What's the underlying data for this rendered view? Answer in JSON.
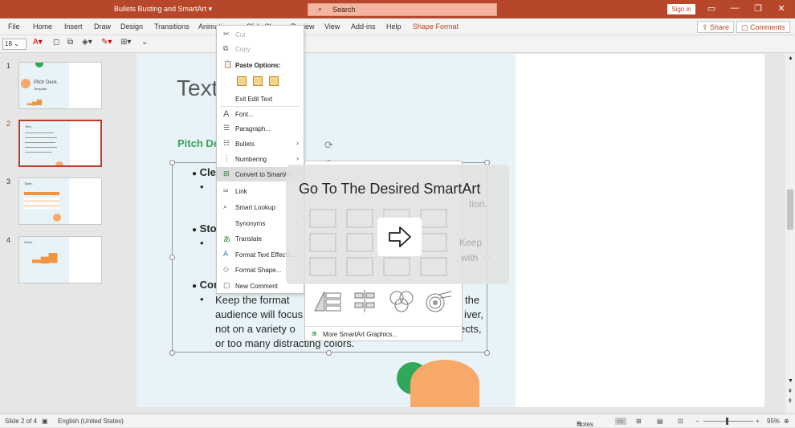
{
  "app": {
    "document_title": "Bullets Busting and SmartArt",
    "search_placeholder": "Search",
    "sign_in": "Sign in",
    "brand_color": "#b7472a"
  },
  "menu": {
    "items": [
      "File",
      "Home",
      "Insert",
      "Draw",
      "Design",
      "Transitions",
      "Animations",
      "Slide Show",
      "Review",
      "View",
      "Add-ins",
      "Help",
      "Shape Format"
    ],
    "share": "Share",
    "comments": "Comments"
  },
  "toolbar": {
    "font_size": "18"
  },
  "thumbnails": [
    {
      "number": "1",
      "title": "Pitch Deck.",
      "subtitle": "Template"
    },
    {
      "number": "2",
      "title": "Text..",
      "subtitle": ""
    },
    {
      "number": "3",
      "title": "Table..",
      "subtitle": ""
    },
    {
      "number": "4",
      "title": "Chart..",
      "subtitle": ""
    }
  ],
  "slide": {
    "title": "Text",
    "subheading": "Pitch De",
    "bullets": [
      {
        "head": "Clear",
        "sub": []
      },
      {
        "head": "Story",
        "sub": []
      },
      {
        "head": "Cons",
        "sub": [
          "Keep the format",
          "the",
          "audience will focus",
          "iver,",
          "not on a variety o",
          "ects,",
          "or too many distracting colors."
        ]
      }
    ],
    "peek_text": [
      "tion.",
      "Keep",
      "with"
    ]
  },
  "context_menu": {
    "items": [
      {
        "label": "Cut",
        "icon": "cut-icon",
        "disabled": true
      },
      {
        "label": "Copy",
        "icon": "copy-icon",
        "disabled": true
      },
      {
        "label": "Paste Options:",
        "icon": "paste-icon",
        "bold": true
      },
      {
        "label": "Exit Edit Text",
        "icon": ""
      },
      {
        "label": "Font...",
        "icon": "font-icon"
      },
      {
        "label": "Paragraph...",
        "icon": "paragraph-icon"
      },
      {
        "label": "Bullets",
        "icon": "bullets-icon",
        "submenu": true
      },
      {
        "label": "Numbering",
        "icon": "numbering-icon",
        "submenu": true
      },
      {
        "label": "Convert to SmartArt",
        "icon": "smartart-icon",
        "submenu": true,
        "hover": true
      },
      {
        "label": "Link",
        "icon": "link-icon"
      },
      {
        "label": "Smart Lookup",
        "icon": "search-icon"
      },
      {
        "label": "Synonyms",
        "icon": "",
        "submenu": true
      },
      {
        "label": "Translate",
        "icon": "translate-icon"
      },
      {
        "label": "Format Text Effects...",
        "icon": "text-effects-icon"
      },
      {
        "label": "Format Shape...",
        "icon": "format-shape-icon"
      },
      {
        "label": "New Comment",
        "icon": "comment-icon"
      }
    ]
  },
  "smartart": {
    "more_label": "More SmartArt Graphics..."
  },
  "overlay": {
    "title": "Go To The Desired SmartArt"
  },
  "status": {
    "slide_count": "Slide 2 of 4",
    "language": "English (United States)",
    "notes": "Notes",
    "zoom": "95%"
  }
}
